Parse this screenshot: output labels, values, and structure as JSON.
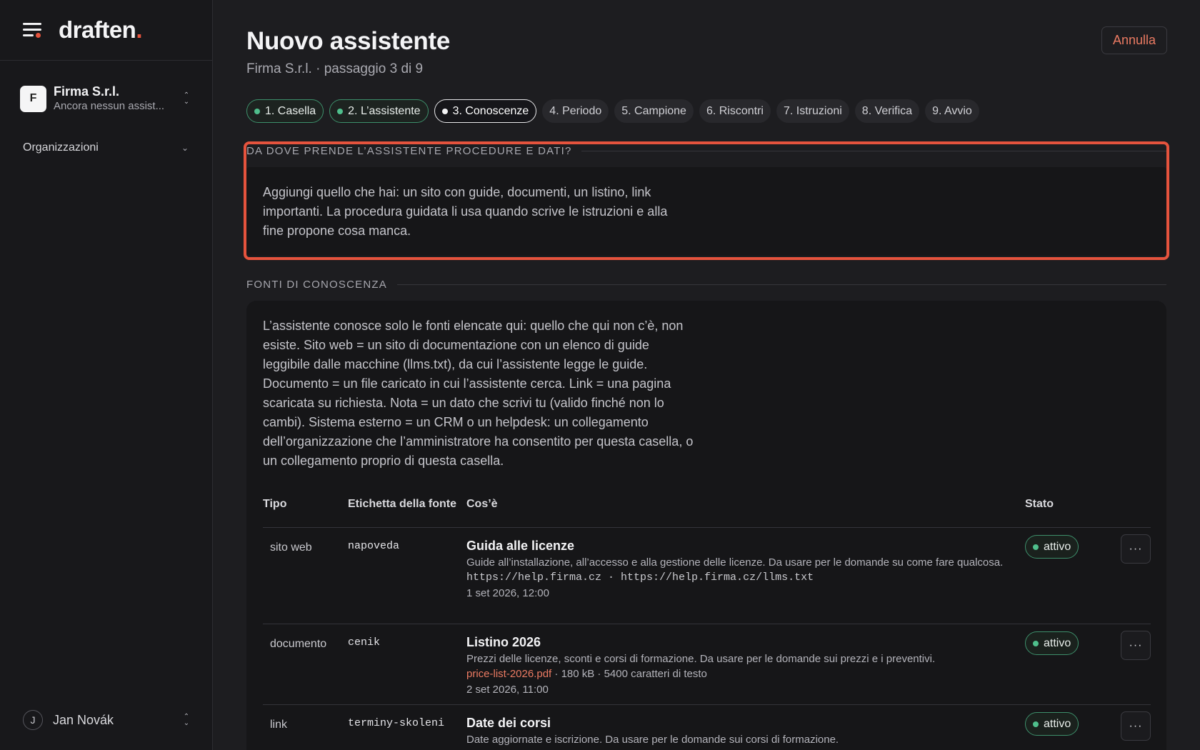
{
  "sidebar": {
    "brand": "draften",
    "brand_dot": ".",
    "org": {
      "initial": "F",
      "name": "Firma S.r.l.",
      "subtitle": "Ancora nessun assist..."
    },
    "nav": {
      "organizations": "Organizzazioni"
    },
    "user": {
      "initial": "J",
      "name": "Jan Novák"
    }
  },
  "header": {
    "title": "Nuovo assistente",
    "subtitle": "Firma S.r.l. · passaggio 3 di 9",
    "cancel_label": "Annulla"
  },
  "steps": [
    {
      "label": "1. Casella",
      "state": "done"
    },
    {
      "label": "2. L’assistente",
      "state": "done"
    },
    {
      "label": "3. Conoscenze",
      "state": "current"
    },
    {
      "label": "4. Periodo",
      "state": "todo"
    },
    {
      "label": "5. Campione",
      "state": "todo"
    },
    {
      "label": "6. Riscontri",
      "state": "todo"
    },
    {
      "label": "7. Istruzioni",
      "state": "todo"
    },
    {
      "label": "8. Verifica",
      "state": "todo"
    },
    {
      "label": "9. Avvio",
      "state": "todo"
    }
  ],
  "intro": {
    "heading": "Da dove prende l’assistente procedure e dati?",
    "text": "Aggiungi quello che hai: un sito con guide, documenti, un listino, link importanti. La procedura guidata li usa quando scrive le istruzioni e alla fine propone cosa manca."
  },
  "sources": {
    "heading": "Fonti di conoscenza",
    "text": "L’assistente conosce solo le fonti elencate qui: quello che qui non c’è, non esiste. Sito web = un sito di documentazione con un elenco di guide leggibile dalle macchine (llms.txt), da cui l’assistente legge le guide. Documento = un file caricato in cui l’assistente cerca. Link = una pagina scaricata su richiesta. Nota = un dato che scrivi tu (valido finché non lo cambi). Sistema esterno = un CRM o un helpdesk: un collegamento dell’organizzazione che l’amministratore ha consentito per questa casella, o un collegamento proprio di questa casella.",
    "columns": {
      "type": "Tipo",
      "label": "Etichetta della fonte",
      "what": "Cos’è",
      "state": "Stato"
    },
    "rows": [
      {
        "type": "sito web",
        "label": "napoveda",
        "title": "Guida alle licenze",
        "desc": "Guide all’installazione, all’accesso e alla gestione delle licenze. Da usare per le domande su come fare qualcosa.",
        "urls": "https://help.firma.cz · https://help.firma.cz/llms.txt",
        "date": "1 set 2026, 12:00",
        "status": "attivo"
      },
      {
        "type": "documento",
        "label": "cenik",
        "title": "Listino 2026",
        "desc": "Prezzi delle licenze, sconti e corsi di formazione. Da usare per le domande sui prezzi e i preventivi.",
        "file": "price-list-2026.pdf",
        "file_meta": " · 180 kB · 5400 caratteri di testo",
        "date": "2 set 2026, 11:00",
        "status": "attivo"
      },
      {
        "type": "link",
        "label": "terminy-skoleni",
        "title": "Date dei corsi",
        "desc": "Date aggiornate e iscrizione. Da usare per le domande sui corsi di formazione.",
        "status": "attivo"
      }
    ],
    "more_label": "···"
  },
  "colors": {
    "accent": "#e5533d",
    "success": "#4fbf8c",
    "background": "#1d1d20"
  }
}
